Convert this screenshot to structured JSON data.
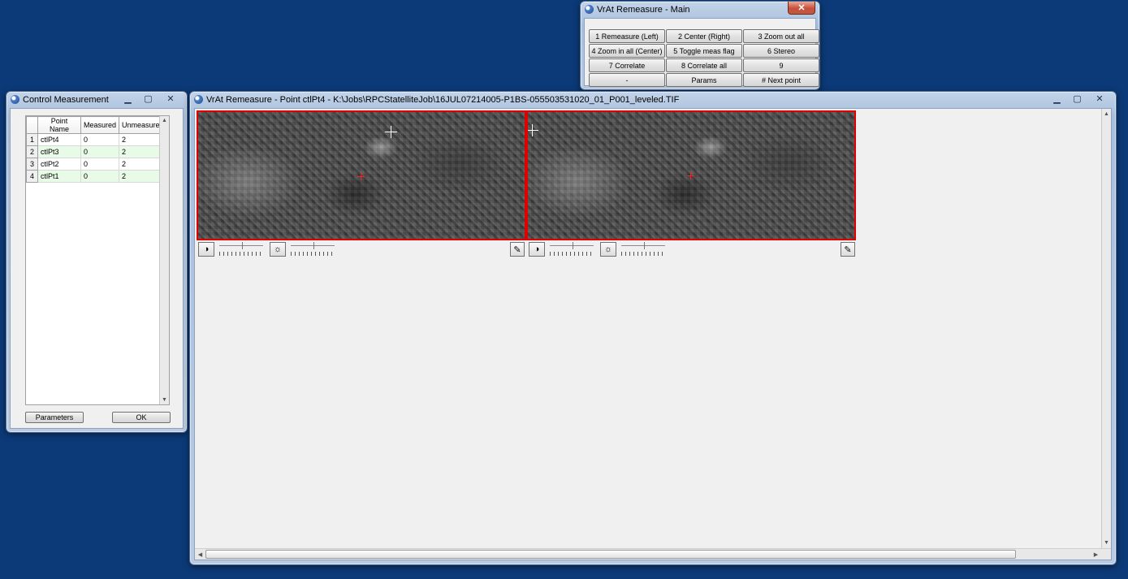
{
  "main_window": {
    "title": "VrAt Remeasure - Main",
    "buttons": [
      "1 Remeasure (Left)",
      "2 Center (Right)",
      "3 Zoom out all",
      "4 Zoom in all (Center)",
      "5 Toggle meas flag",
      "6 Stereo",
      "7 Correlate",
      "8 Correlate all",
      "9",
      "-",
      "Params",
      "# Next point"
    ]
  },
  "control_window": {
    "title": "Control Measurement",
    "columns": [
      "Point Name",
      "Measured",
      "Unmeasured"
    ],
    "rows": [
      {
        "num": "1",
        "name": "ctlPt4",
        "measured": "0",
        "unmeasured": "2"
      },
      {
        "num": "2",
        "name": "ctlPt3",
        "measured": "0",
        "unmeasured": "2"
      },
      {
        "num": "3",
        "name": "ctlPt2",
        "measured": "0",
        "unmeasured": "2"
      },
      {
        "num": "4",
        "name": "ctlPt1",
        "measured": "0",
        "unmeasured": "2"
      }
    ],
    "parameters_label": "Parameters",
    "ok_label": "OK"
  },
  "point_window": {
    "title": "VrAt Remeasure - Point ctlPt4 - K:\\Jobs\\RPCStatelliteJob\\16JUL07214005-P1BS-055503531020_01_P001_leveled.TIF"
  },
  "icons": {
    "contrast": "contrast-icon",
    "brightness": "brightness-icon",
    "reset": "reset-brush-icon"
  },
  "colors": {
    "desktop": "#0c3a78",
    "panel_border": "#e00000",
    "alt_row": "#e8fbe6"
  }
}
